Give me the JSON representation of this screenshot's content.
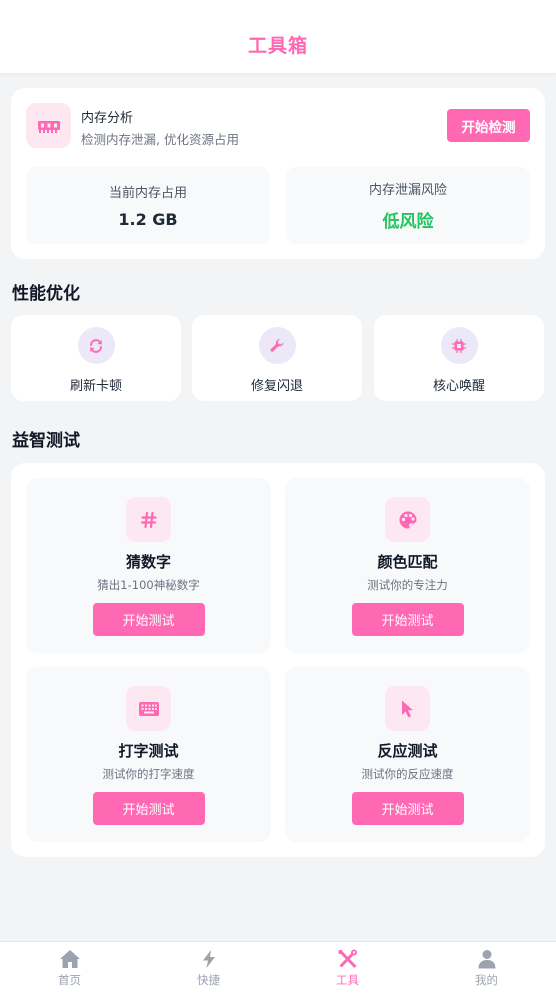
{
  "header": {
    "title": "工具箱"
  },
  "memory": {
    "icon": "memory-chip-icon",
    "title": "内存分析",
    "description": "检测内存泄漏, 优化资源占用",
    "button_label": "开始检测",
    "stats": [
      {
        "label": "当前内存占用",
        "value": "1.2 GB"
      },
      {
        "label": "内存泄漏风险",
        "value": "低风险",
        "color": "#22c55e"
      }
    ]
  },
  "performance": {
    "section_title": "性能优化",
    "items": [
      {
        "label": "刷新卡顿",
        "icon": "refresh-icon"
      },
      {
        "label": "修复闪退",
        "icon": "wrench-icon"
      },
      {
        "label": "核心唤醒",
        "icon": "cpu-icon"
      }
    ]
  },
  "games": {
    "section_title": "益智测试",
    "items": [
      {
        "title": "猜数字",
        "description": "猜出1-100神秘数字",
        "button_label": "开始测试",
        "icon": "hashtag-icon"
      },
      {
        "title": "颜色匹配",
        "description": "测试你的专注力",
        "button_label": "开始测试",
        "icon": "palette-icon"
      },
      {
        "title": "打字测试",
        "description": "测试你的打字速度",
        "button_label": "开始测试",
        "icon": "keyboard-icon"
      },
      {
        "title": "反应测试",
        "description": "测试你的反应速度",
        "button_label": "开始测试",
        "icon": "pointer-icon"
      }
    ]
  },
  "tabbar": {
    "items": [
      {
        "label": "首页",
        "icon": "home-icon"
      },
      {
        "label": "快捷",
        "icon": "bolt-icon"
      },
      {
        "label": "工具",
        "icon": "tools-icon",
        "active": true
      },
      {
        "label": "我的",
        "icon": "user-icon"
      }
    ]
  },
  "colors": {
    "accent": "#ff69b4",
    "accent_light": "#fde7f1",
    "success": "#22c55e",
    "background": "#f3f4f6",
    "tab_inactive": "#9ca3af"
  }
}
